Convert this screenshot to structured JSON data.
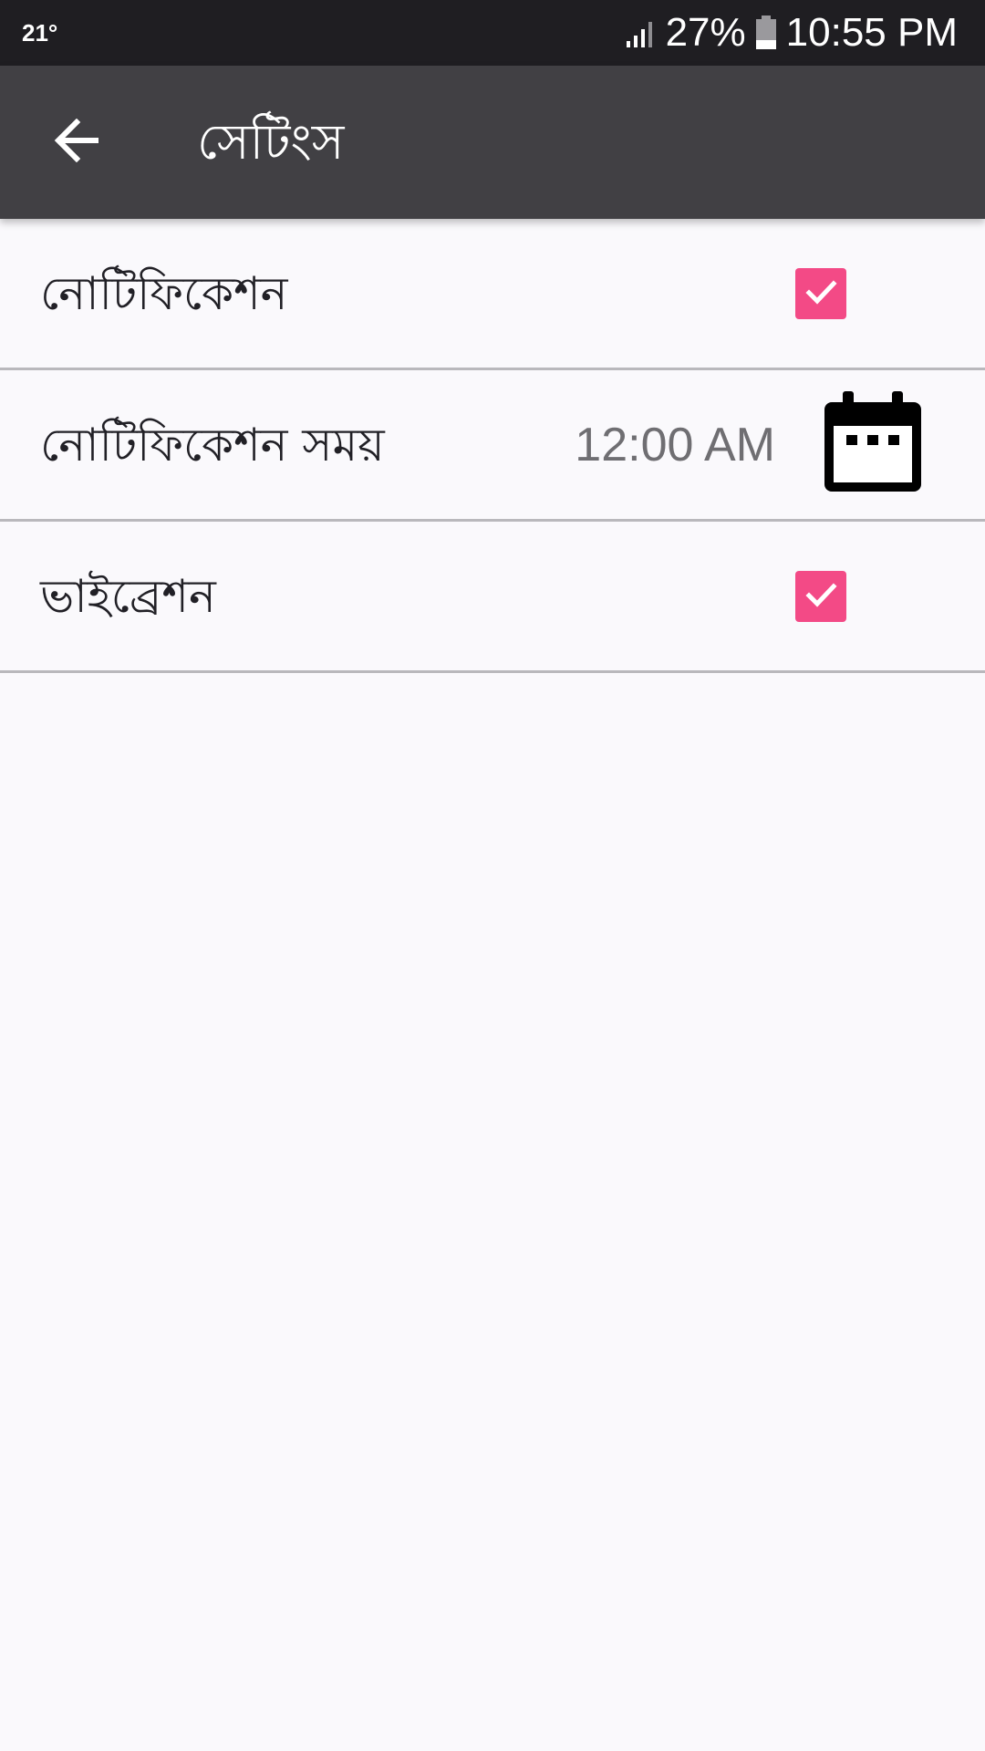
{
  "status_bar": {
    "temperature": "21°",
    "battery_percent": "27%",
    "time": "10:55 PM",
    "signal_icon": "cell-signal-icon",
    "battery_icon": "battery-icon"
  },
  "app_bar": {
    "title": "সেটিংস",
    "back_icon": "arrow-back-icon",
    "background": "#414044"
  },
  "settings": {
    "notification": {
      "label": "নোটিফিকেশন",
      "checked": true
    },
    "notification_time": {
      "label": "নোটিফিকেশন সময়",
      "value": "12:00 AM",
      "icon": "calendar-icon"
    },
    "vibration": {
      "label": "ভাইব্রেশন",
      "checked": true
    }
  },
  "colors": {
    "accent": "#f34a86",
    "status_bar": "#1f1e22",
    "background": "#faf9fc",
    "divider": "#b9b8bc"
  }
}
